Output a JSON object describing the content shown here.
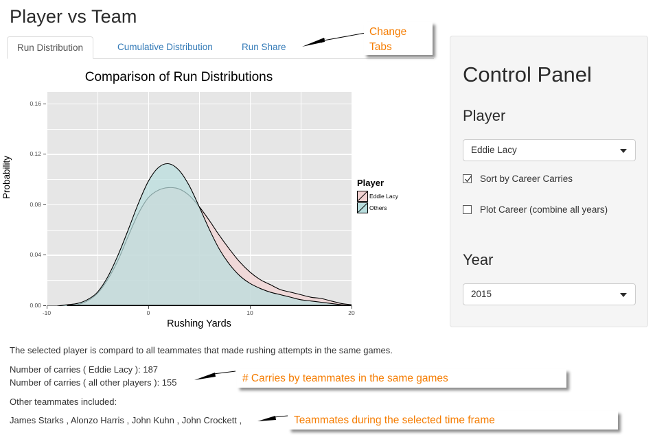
{
  "page_title": "Player vs Team",
  "tabs": [
    {
      "label": "Run Distribution",
      "active": true
    },
    {
      "label": "Cumulative Distribution",
      "active": false
    },
    {
      "label": "Run Share",
      "active": false
    }
  ],
  "chart_data": {
    "type": "area",
    "title": "Comparison of Run Distributions",
    "xlabel": "Rushing Yards",
    "ylabel": "Probability",
    "xlim": [
      -10,
      20
    ],
    "ylim": [
      0,
      0.17
    ],
    "xticks": [
      "-10",
      "0",
      "10",
      "20"
    ],
    "xtick_values": [
      -10,
      0,
      10,
      20
    ],
    "yticks": [
      "0.00",
      "0.04",
      "0.08",
      "0.12",
      "0.16"
    ],
    "ytick_values": [
      0.0,
      0.04,
      0.08,
      0.12,
      0.16
    ],
    "grid": true,
    "legend_position": "right",
    "legend_title": "Player",
    "series": [
      {
        "name": "Eddie Lacy",
        "color": "#f2d2d2",
        "line_color": "#000000",
        "x": [
          -10,
          -9,
          -8,
          -7,
          -6,
          -5,
          -4,
          -3,
          -2,
          -1,
          0,
          1,
          2,
          3,
          4,
          5,
          6,
          7,
          8,
          9,
          10,
          11,
          12,
          13,
          14,
          15,
          16,
          17,
          18,
          19,
          20
        ],
        "y": [
          0.0,
          0.0,
          0.0,
          0.001,
          0.004,
          0.01,
          0.021,
          0.036,
          0.055,
          0.073,
          0.086,
          0.092,
          0.094,
          0.093,
          0.088,
          0.079,
          0.068,
          0.056,
          0.045,
          0.035,
          0.027,
          0.021,
          0.017,
          0.013,
          0.011,
          0.009,
          0.007,
          0.006,
          0.004,
          0.002,
          0.001
        ]
      },
      {
        "name": "Others",
        "color": "#b9dede",
        "line_color": "#000000",
        "x": [
          -10,
          -9,
          -8,
          -7,
          -6,
          -5,
          -4,
          -3,
          -2,
          -1,
          0,
          1,
          2,
          3,
          4,
          5,
          6,
          7,
          8,
          9,
          10,
          11,
          12,
          13,
          14,
          15,
          16,
          17,
          18,
          19,
          20
        ],
        "y": [
          0.0,
          0.0,
          0.001,
          0.002,
          0.005,
          0.011,
          0.023,
          0.04,
          0.06,
          0.081,
          0.099,
          0.11,
          0.113,
          0.108,
          0.096,
          0.079,
          0.061,
          0.045,
          0.033,
          0.024,
          0.018,
          0.014,
          0.011,
          0.009,
          0.007,
          0.005,
          0.004,
          0.003,
          0.002,
          0.001,
          0.0
        ]
      }
    ],
    "panel_background": "#e6e6e6",
    "grid_color": "#ffffff",
    "overlap_color": "#b5c9c7"
  },
  "control_panel": {
    "title": "Control Panel",
    "player_label": "Player",
    "player_value": "Eddie Lacy",
    "sort_checkbox_label": "Sort by Career Carries",
    "sort_checkbox_checked": true,
    "career_checkbox_label": "Plot Career (combine all years)",
    "career_checkbox_checked": false,
    "year_label": "Year",
    "year_value": "2015"
  },
  "footer": {
    "description": "The selected player is compard to all teammates that made rushing attempts in the same games.",
    "carries_player": "Number of carries ( Eddie Lacy ): 187",
    "carries_others": "Number of carries ( all other players ): 155",
    "others_included_label": "Other teammates included:",
    "teammates_list": "James Starks , Alonzo Harris , John Kuhn , John Crockett ,"
  },
  "annotations": {
    "change_tabs": "Change\nTabs",
    "carries": "# Carries by teammates in the same games",
    "teammates": "Teammates during the selected time frame",
    "color": "#f57c00"
  }
}
